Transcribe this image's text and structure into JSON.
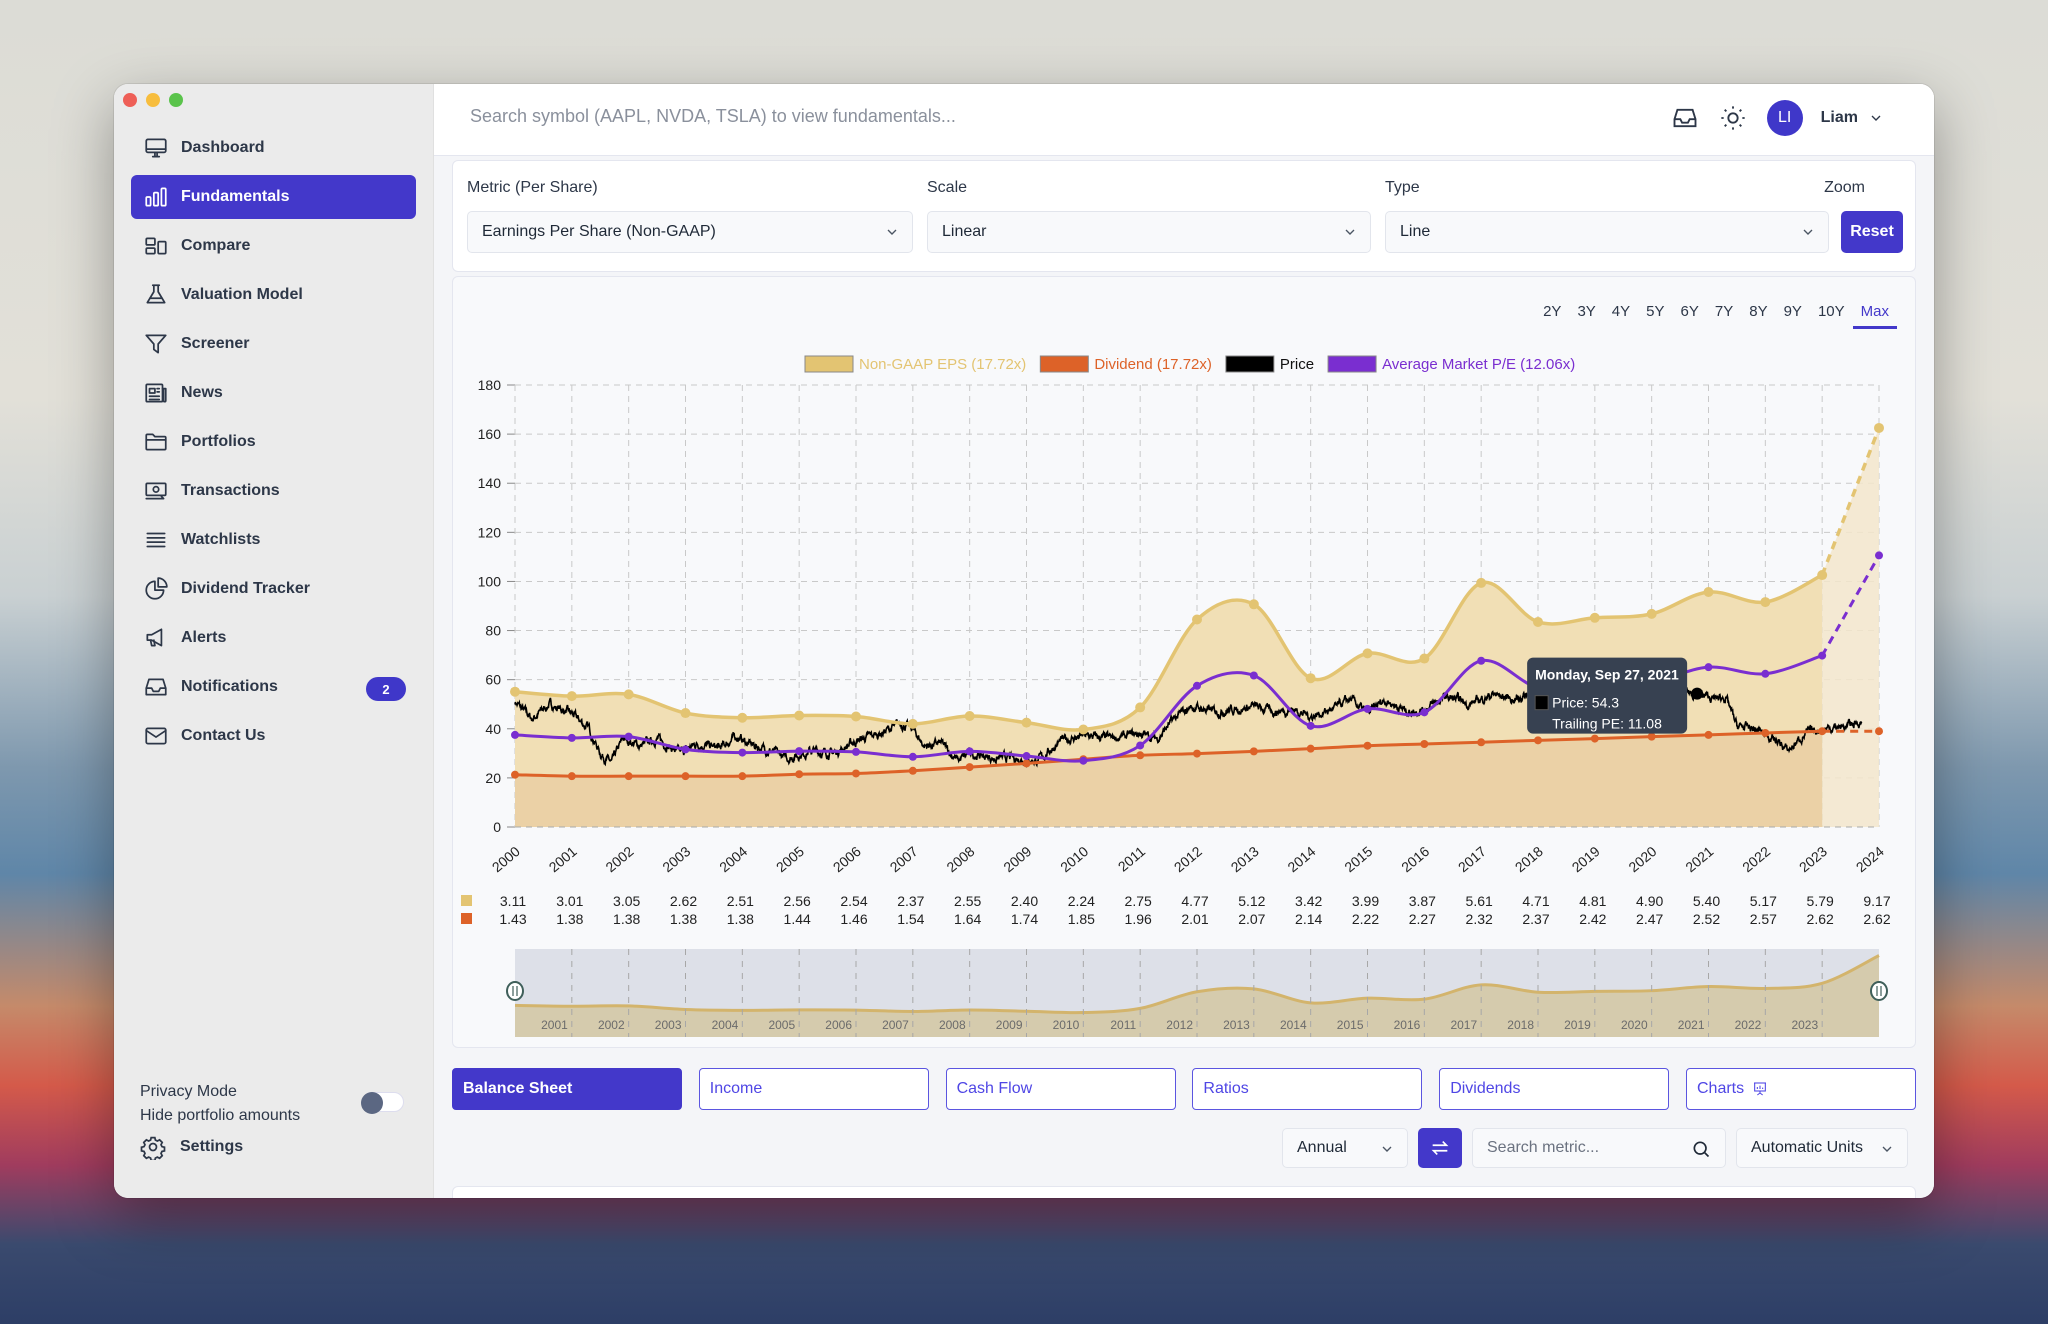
{
  "window": {
    "traffic_lights": [
      "close",
      "minimize",
      "maximize"
    ]
  },
  "sidebar": {
    "items": [
      {
        "label": "Dashboard",
        "icon": "monitor-icon",
        "active": false
      },
      {
        "label": "Fundamentals",
        "icon": "bar-chart-icon",
        "active": true
      },
      {
        "label": "Compare",
        "icon": "compare-icon",
        "active": false
      },
      {
        "label": "Valuation Model",
        "icon": "flask-icon",
        "active": false
      },
      {
        "label": "Screener",
        "icon": "filter-icon",
        "active": false
      },
      {
        "label": "News",
        "icon": "newspaper-icon",
        "active": false
      },
      {
        "label": "Portfolios",
        "icon": "folder-icon",
        "active": false
      },
      {
        "label": "Transactions",
        "icon": "cash-icon",
        "active": false
      },
      {
        "label": "Watchlists",
        "icon": "list-icon",
        "active": false
      },
      {
        "label": "Dividend Tracker",
        "icon": "pie-chart-icon",
        "active": false
      },
      {
        "label": "Alerts",
        "icon": "megaphone-icon",
        "active": false
      },
      {
        "label": "Notifications",
        "icon": "inbox-icon",
        "active": false,
        "badge": "2"
      },
      {
        "label": "Contact Us",
        "icon": "mail-icon",
        "active": false
      }
    ],
    "privacy": {
      "title": "Privacy Mode",
      "subtitle": "Hide portfolio amounts",
      "enabled": false
    },
    "settings_label": "Settings"
  },
  "topbar": {
    "search_placeholder": "Search symbol (AAPL, NVDA, TSLA) to view fundamentals...",
    "user": {
      "initials": "LI",
      "name": "Liam"
    }
  },
  "controls": {
    "metric": {
      "label": "Metric (Per Share)",
      "value": "Earnings Per Share (Non-GAAP)"
    },
    "scale": {
      "label": "Scale",
      "value": "Linear"
    },
    "type": {
      "label": "Type",
      "value": "Line"
    },
    "zoom": {
      "label": "Zoom",
      "button": "Reset"
    }
  },
  "ranges": {
    "options": [
      "2Y",
      "3Y",
      "4Y",
      "5Y",
      "6Y",
      "7Y",
      "8Y",
      "9Y",
      "10Y",
      "Max"
    ],
    "active": "Max"
  },
  "colors": {
    "accent": "#4338ca",
    "eps": "#e3c472",
    "dividend": "#dd6228",
    "price": "#000000",
    "pe": "#7a2ed0"
  },
  "chart_data": {
    "type": "line",
    "title": "",
    "xlabel": "",
    "ylabel": "",
    "ylim": [
      0,
      180
    ],
    "yticks": [
      0,
      20,
      40,
      60,
      80,
      100,
      120,
      140,
      160,
      180
    ],
    "grid": true,
    "legend_position": "top-center",
    "x": [
      "2000",
      "2001",
      "2002",
      "2003",
      "2004",
      "2005",
      "2006",
      "2007",
      "2008",
      "2009",
      "2010",
      "2011",
      "2012",
      "2013",
      "2014",
      "2015",
      "2016",
      "2017",
      "2018",
      "2019",
      "2020",
      "2021",
      "2022",
      "2023",
      "2024"
    ],
    "legend": [
      {
        "name": "Non-GAAP EPS (17.72x)",
        "color": "#e3c472"
      },
      {
        "name": "Dividend (17.72x)",
        "color": "#dd6228"
      },
      {
        "name": "Price",
        "color": "#000000"
      },
      {
        "name": "Average Market P/E (12.06x)",
        "color": "#7a2ed0"
      }
    ],
    "series": [
      {
        "name": "Non-GAAP EPS (17.72x)",
        "values": [
          55.1,
          53.3,
          54.0,
          46.4,
          44.5,
          45.4,
          45.0,
          42.0,
          45.2,
          42.5,
          39.7,
          48.7,
          84.5,
          90.7,
          60.6,
          70.7,
          68.6,
          99.4,
          83.5,
          85.2,
          86.8,
          95.7,
          91.6,
          102.6,
          162.5
        ],
        "projected_from_index": 23
      },
      {
        "name": "Dividend (17.72x)",
        "values": [
          21.3,
          20.7,
          20.7,
          20.7,
          20.7,
          21.5,
          21.8,
          22.9,
          24.4,
          25.9,
          27.6,
          29.2,
          29.9,
          30.8,
          31.9,
          33.1,
          33.8,
          34.5,
          35.3,
          36.0,
          36.8,
          37.5,
          38.3,
          39.0,
          39.0
        ],
        "projected_from_index": 23
      },
      {
        "name": "Average Market P/E (12.06x)",
        "values": [
          37.5,
          36.3,
          36.8,
          31.6,
          30.3,
          30.9,
          30.6,
          28.6,
          30.8,
          28.9,
          27.0,
          33.2,
          57.5,
          61.7,
          41.2,
          48.1,
          46.7,
          67.7,
          56.8,
          58.0,
          59.1,
          65.1,
          62.4,
          69.8,
          110.6
        ],
        "projected_from_index": 23
      },
      {
        "name": "Price",
        "daily": true,
        "anchors": [
          [
            2000.0,
            51
          ],
          [
            2000.3,
            44
          ],
          [
            2000.6,
            50
          ],
          [
            2001.0,
            46
          ],
          [
            2001.3,
            40
          ],
          [
            2001.5,
            30
          ],
          [
            2001.7,
            26
          ],
          [
            2001.9,
            36
          ],
          [
            2002.2,
            33
          ],
          [
            2002.5,
            36
          ],
          [
            2002.9,
            30
          ],
          [
            2003.2,
            34
          ],
          [
            2003.6,
            32
          ],
          [
            2003.9,
            37
          ],
          [
            2004.1,
            34
          ],
          [
            2004.5,
            31
          ],
          [
            2004.8,
            28
          ],
          [
            2005.2,
            31
          ],
          [
            2005.6,
            30
          ],
          [
            2006.0,
            35
          ],
          [
            2006.4,
            38
          ],
          [
            2006.8,
            42
          ],
          [
            2007.0,
            40
          ],
          [
            2007.2,
            33
          ],
          [
            2007.5,
            34
          ],
          [
            2007.8,
            27
          ],
          [
            2008.0,
            30
          ],
          [
            2008.4,
            28
          ],
          [
            2008.8,
            28
          ],
          [
            2009.2,
            27
          ],
          [
            2009.6,
            35
          ],
          [
            2010.0,
            37
          ],
          [
            2010.5,
            36
          ],
          [
            2011.0,
            38
          ],
          [
            2011.3,
            36
          ],
          [
            2011.6,
            44
          ],
          [
            2011.9,
            49
          ],
          [
            2012.3,
            47
          ],
          [
            2012.7,
            48
          ],
          [
            2013.0,
            49
          ],
          [
            2013.4,
            47
          ],
          [
            2013.7,
            48
          ],
          [
            2014.0,
            45
          ],
          [
            2014.4,
            48
          ],
          [
            2014.7,
            52
          ],
          [
            2015.0,
            46
          ],
          [
            2015.3,
            52
          ],
          [
            2015.7,
            47
          ],
          [
            2016.0,
            48
          ],
          [
            2016.4,
            53
          ],
          [
            2016.8,
            50
          ],
          [
            2017.2,
            54
          ],
          [
            2017.6,
            52
          ],
          [
            2018.0,
            56
          ],
          [
            2018.4,
            53
          ],
          [
            2018.8,
            56
          ],
          [
            2019.2,
            54
          ],
          [
            2019.6,
            55
          ],
          [
            2020.0,
            53
          ],
          [
            2020.4,
            55
          ],
          [
            2020.8,
            54.3
          ],
          [
            2021.1,
            52
          ],
          [
            2021.3,
            53
          ],
          [
            2021.5,
            41
          ],
          [
            2021.8,
            40
          ],
          [
            2022.1,
            37
          ],
          [
            2022.4,
            31
          ],
          [
            2022.7,
            38
          ],
          [
            2023.0,
            40
          ],
          [
            2023.4,
            41
          ],
          [
            2023.7,
            43
          ]
        ]
      }
    ],
    "tooltip": {
      "date": "Monday, Sep 27, 2021",
      "lines": [
        "Price: 54.3",
        "Trailing PE: 11.08"
      ]
    },
    "table": {
      "eps": [
        "3.11",
        "3.01",
        "3.05",
        "2.62",
        "2.51",
        "2.56",
        "2.54",
        "2.37",
        "2.55",
        "2.40",
        "2.24",
        "2.75",
        "4.77",
        "5.12",
        "3.42",
        "3.99",
        "3.87",
        "5.61",
        "4.71",
        "4.81",
        "4.90",
        "5.40",
        "5.17",
        "5.79",
        "9.17"
      ],
      "dividend": [
        "1.43",
        "1.38",
        "1.38",
        "1.38",
        "1.38",
        "1.44",
        "1.46",
        "1.54",
        "1.64",
        "1.74",
        "1.85",
        "1.96",
        "2.01",
        "2.07",
        "2.14",
        "2.22",
        "2.27",
        "2.32",
        "2.37",
        "2.42",
        "2.47",
        "2.52",
        "2.57",
        "2.62",
        "2.62"
      ]
    },
    "navigator": {
      "x_labels": [
        "2001",
        "2002",
        "2003",
        "2004",
        "2005",
        "2006",
        "2007",
        "2008",
        "2009",
        "2010",
        "2011",
        "2012",
        "2013",
        "2014",
        "2015",
        "2016",
        "2017",
        "2018",
        "2019",
        "2020",
        "2021",
        "2022",
        "2023"
      ]
    }
  },
  "tabs": [
    {
      "label": "Balance Sheet",
      "active": true
    },
    {
      "label": "Income",
      "active": false
    },
    {
      "label": "Cash Flow",
      "active": false
    },
    {
      "label": "Ratios",
      "active": false
    },
    {
      "label": "Dividends",
      "active": false
    },
    {
      "label": "Charts",
      "active": false,
      "icon": "presentation-chart-icon"
    }
  ],
  "table_controls": {
    "period": "Annual",
    "search_placeholder": "Search metric...",
    "units": "Automatic Units"
  }
}
